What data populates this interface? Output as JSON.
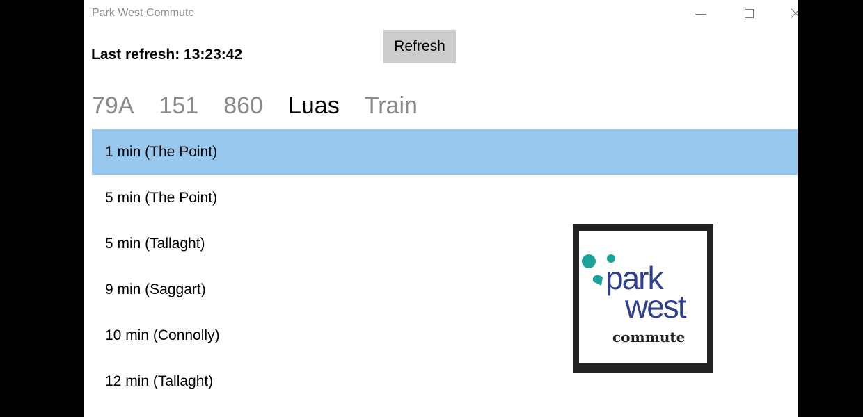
{
  "window": {
    "title": "Park West Commute"
  },
  "header": {
    "last_refresh": "Last refresh: 13:23:42",
    "refresh_button": "Refresh"
  },
  "tabs": [
    {
      "label": "79A",
      "active": false
    },
    {
      "label": "151",
      "active": false
    },
    {
      "label": "860",
      "active": false
    },
    {
      "label": "Luas",
      "active": true
    },
    {
      "label": "Train",
      "active": false
    }
  ],
  "arrivals": [
    {
      "text": "1 min (The Point)",
      "selected": true
    },
    {
      "text": "5 min (The Point)",
      "selected": false
    },
    {
      "text": "5 min (Tallaght)",
      "selected": false
    },
    {
      "text": "9 min (Saggart)",
      "selected": false
    },
    {
      "text": "10 min (Connolly)",
      "selected": false
    },
    {
      "text": "12 min (Tallaght)",
      "selected": false
    }
  ],
  "logo": {
    "word1": "park",
    "word2": "west",
    "tagline": "commute",
    "teal": "#1aa39a",
    "navy": "#2e3f8f"
  },
  "colors": {
    "selection": "#99c8ee",
    "button_bg": "#cccccc"
  }
}
